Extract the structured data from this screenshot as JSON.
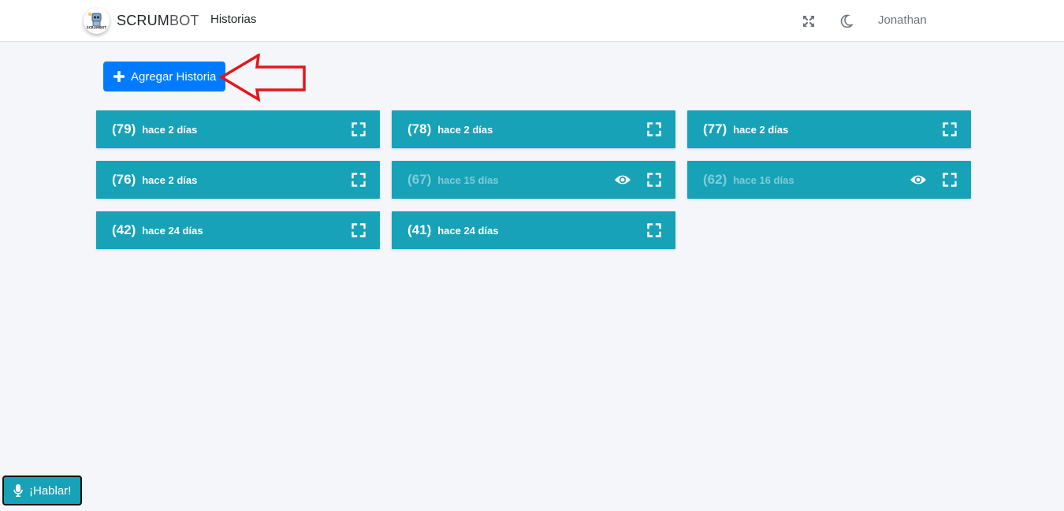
{
  "header": {
    "brand_bold": "SCRUM",
    "brand_light": "BOT",
    "nav_historias": "Historias",
    "user_name": "Jonathan",
    "icons": [
      "logo-icon",
      "expand-screen-icon",
      "moon-icon"
    ]
  },
  "actions": {
    "add_story_label": "Agregar Historia",
    "talk_label": "¡Hablar!"
  },
  "stories": [
    {
      "id": "(79)",
      "time": "hace 2 días",
      "muted": false,
      "has_eye": false
    },
    {
      "id": "(78)",
      "time": "hace 2 días",
      "muted": false,
      "has_eye": false
    },
    {
      "id": "(77)",
      "time": "hace 2 días",
      "muted": false,
      "has_eye": false
    },
    {
      "id": "(76)",
      "time": "hace 2 días",
      "muted": false,
      "has_eye": false
    },
    {
      "id": "(67)",
      "time": "hace 15 días",
      "muted": true,
      "has_eye": true
    },
    {
      "id": "(62)",
      "time": "hace 16 días",
      "muted": true,
      "has_eye": true
    },
    {
      "id": "(42)",
      "time": "hace 24 días",
      "muted": false,
      "has_eye": false
    },
    {
      "id": "(41)",
      "time": "hace 24 días",
      "muted": false,
      "has_eye": false
    }
  ],
  "colors": {
    "primary": "#007bff",
    "card": "#17a2b8",
    "annotation_arrow": "#e3161d",
    "background": "#f4f6f9"
  }
}
